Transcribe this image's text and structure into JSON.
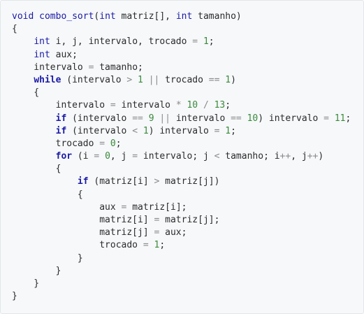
{
  "code": {
    "lines": [
      [
        [
          "kw",
          "void"
        ],
        [
          "plain",
          " "
        ],
        [
          "kw",
          "combo_sort"
        ],
        [
          "plain",
          "("
        ],
        [
          "kw",
          "int"
        ],
        [
          "plain",
          " matriz[], "
        ],
        [
          "kw",
          "int"
        ],
        [
          "plain",
          " tamanho)"
        ]
      ],
      [
        [
          "plain",
          "{"
        ]
      ],
      [
        [
          "plain",
          "    "
        ],
        [
          "kw",
          "int"
        ],
        [
          "plain",
          " i, j, intervalo, trocado "
        ],
        [
          "op",
          "="
        ],
        [
          "plain",
          " "
        ],
        [
          "num",
          "1"
        ],
        [
          "plain",
          ";"
        ]
      ],
      [
        [
          "plain",
          "    "
        ],
        [
          "kw",
          "int"
        ],
        [
          "plain",
          " aux;"
        ]
      ],
      [
        [
          "plain",
          "    intervalo "
        ],
        [
          "op",
          "="
        ],
        [
          "plain",
          " tamanho;"
        ]
      ],
      [
        [
          "plain",
          "    "
        ],
        [
          "kwb",
          "while"
        ],
        [
          "plain",
          " (intervalo "
        ],
        [
          "op",
          ">"
        ],
        [
          "plain",
          " "
        ],
        [
          "num",
          "1"
        ],
        [
          "plain",
          " "
        ],
        [
          "op",
          "||"
        ],
        [
          "plain",
          " trocado "
        ],
        [
          "op",
          "=="
        ],
        [
          "plain",
          " "
        ],
        [
          "num",
          "1"
        ],
        [
          "plain",
          ")"
        ]
      ],
      [
        [
          "plain",
          "    {"
        ]
      ],
      [
        [
          "plain",
          "        intervalo "
        ],
        [
          "op",
          "="
        ],
        [
          "plain",
          " intervalo "
        ],
        [
          "op",
          "*"
        ],
        [
          "plain",
          " "
        ],
        [
          "num",
          "10"
        ],
        [
          "plain",
          " "
        ],
        [
          "op",
          "/"
        ],
        [
          "plain",
          " "
        ],
        [
          "num",
          "13"
        ],
        [
          "plain",
          ";"
        ]
      ],
      [
        [
          "plain",
          "        "
        ],
        [
          "kwb",
          "if"
        ],
        [
          "plain",
          " (intervalo "
        ],
        [
          "op",
          "=="
        ],
        [
          "plain",
          " "
        ],
        [
          "num",
          "9"
        ],
        [
          "plain",
          " "
        ],
        [
          "op",
          "||"
        ],
        [
          "plain",
          " intervalo "
        ],
        [
          "op",
          "=="
        ],
        [
          "plain",
          " "
        ],
        [
          "num",
          "10"
        ],
        [
          "plain",
          ") intervalo "
        ],
        [
          "op",
          "="
        ],
        [
          "plain",
          " "
        ],
        [
          "num",
          "11"
        ],
        [
          "plain",
          ";"
        ]
      ],
      [
        [
          "plain",
          "        "
        ],
        [
          "kwb",
          "if"
        ],
        [
          "plain",
          " (intervalo "
        ],
        [
          "op",
          "<"
        ],
        [
          "plain",
          " "
        ],
        [
          "num",
          "1"
        ],
        [
          "plain",
          ") intervalo "
        ],
        [
          "op",
          "="
        ],
        [
          "plain",
          " "
        ],
        [
          "num",
          "1"
        ],
        [
          "plain",
          ";"
        ]
      ],
      [
        [
          "plain",
          "        trocado "
        ],
        [
          "op",
          "="
        ],
        [
          "plain",
          " "
        ],
        [
          "num",
          "0"
        ],
        [
          "plain",
          ";"
        ]
      ],
      [
        [
          "plain",
          "        "
        ],
        [
          "kwb",
          "for"
        ],
        [
          "plain",
          " (i "
        ],
        [
          "op",
          "="
        ],
        [
          "plain",
          " "
        ],
        [
          "num",
          "0"
        ],
        [
          "plain",
          ", j "
        ],
        [
          "op",
          "="
        ],
        [
          "plain",
          " intervalo; j "
        ],
        [
          "op",
          "<"
        ],
        [
          "plain",
          " tamanho; i"
        ],
        [
          "op",
          "++"
        ],
        [
          "plain",
          ", j"
        ],
        [
          "op",
          "++"
        ],
        [
          "plain",
          ")"
        ]
      ],
      [
        [
          "plain",
          "        {"
        ]
      ],
      [
        [
          "plain",
          "            "
        ],
        [
          "kwb",
          "if"
        ],
        [
          "plain",
          " (matriz[i] "
        ],
        [
          "op",
          ">"
        ],
        [
          "plain",
          " matriz[j])"
        ]
      ],
      [
        [
          "plain",
          "            {"
        ]
      ],
      [
        [
          "plain",
          "                aux "
        ],
        [
          "op",
          "="
        ],
        [
          "plain",
          " matriz[i];"
        ]
      ],
      [
        [
          "plain",
          "                matriz[i] "
        ],
        [
          "op",
          "="
        ],
        [
          "plain",
          " matriz[j];"
        ]
      ],
      [
        [
          "plain",
          "                matriz[j] "
        ],
        [
          "op",
          "="
        ],
        [
          "plain",
          " aux;"
        ]
      ],
      [
        [
          "plain",
          "                trocado "
        ],
        [
          "op",
          "="
        ],
        [
          "plain",
          " "
        ],
        [
          "num",
          "1"
        ],
        [
          "plain",
          ";"
        ]
      ],
      [
        [
          "plain",
          "            }"
        ]
      ],
      [
        [
          "plain",
          "        }"
        ]
      ],
      [
        [
          "plain",
          "    }"
        ]
      ],
      [
        [
          "plain",
          "}"
        ]
      ]
    ]
  }
}
